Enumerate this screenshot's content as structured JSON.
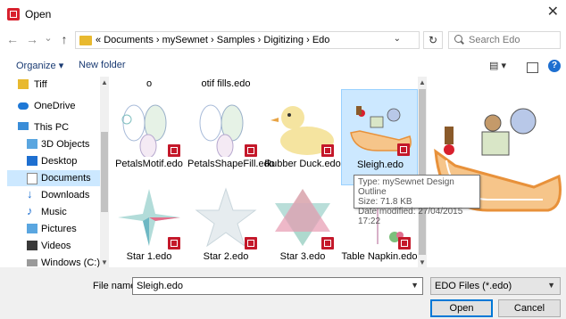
{
  "window": {
    "title": "Open",
    "close_glyph": "✕",
    "app_icon": "app-icon"
  },
  "nav": {
    "back": "←",
    "forward": "→",
    "recent": "⌄",
    "up": "↑",
    "breadcrumb_prefix": "«",
    "crumbs": [
      "Documents",
      "mySewnet",
      "Samples",
      "Digitizing",
      "Edo"
    ],
    "separator": "›",
    "refresh": "↻",
    "search_placeholder": "Search Edo"
  },
  "toolbar": {
    "organize": "Organize ▾",
    "new_folder": "New folder"
  },
  "sidebar": {
    "items": [
      {
        "label": "Tiff",
        "icon": "folder-icon"
      },
      {
        "label": "OneDrive",
        "icon": "cloud-icon"
      },
      {
        "label": "This PC",
        "icon": "computer-icon"
      },
      {
        "label": "3D Objects",
        "icon": "cube-icon"
      },
      {
        "label": "Desktop",
        "icon": "desktop-icon"
      },
      {
        "label": "Documents",
        "icon": "document-icon",
        "selected": true
      },
      {
        "label": "Downloads",
        "icon": "download-icon"
      },
      {
        "label": "Music",
        "icon": "music-icon"
      },
      {
        "label": "Pictures",
        "icon": "pictures-icon"
      },
      {
        "label": "Videos",
        "icon": "video-icon"
      },
      {
        "label": "Windows (C:)",
        "icon": "drive-icon"
      }
    ]
  },
  "files": {
    "partial_top": [
      "o",
      "otif fills.edo"
    ],
    "row1": [
      "PetalsMotif.edo",
      "PetalsShapeFill.edo",
      "Rubber Duck.edo",
      "Sleigh.edo"
    ],
    "row2": [
      "Star 1.edo",
      "Star 2.edo",
      "Star 3.edo",
      "Table Napkin.edo"
    ]
  },
  "tooltip": {
    "type": "Type: mySewnet Design Outline",
    "size": "Size: 71.8 KB",
    "date": "Date modified: 27/04/2015 17:22"
  },
  "bottom": {
    "file_name_label": "File name:",
    "file_name_value": "Sleigh.edo",
    "filter_value": "EDO Files (*.edo)",
    "open": "Open",
    "cancel": "Cancel"
  },
  "colors": {
    "accent": "#0078d7",
    "selection": "#cce8ff",
    "badge": "#c4182a"
  }
}
